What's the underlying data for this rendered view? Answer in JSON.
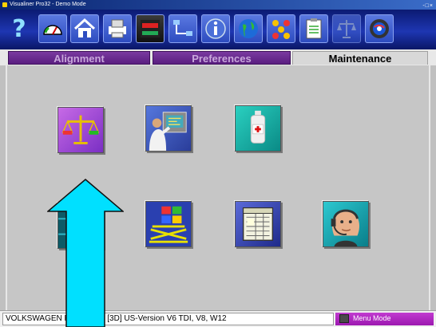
{
  "window": {
    "title": "Visualiner Pro32 - Demo Mode",
    "controls": "-□×"
  },
  "toolbar": {
    "buttons": [
      {
        "icon": "help-icon",
        "glyph": "?"
      },
      {
        "icon": "gauge-icon"
      },
      {
        "icon": "home-icon"
      },
      {
        "icon": "printer-icon"
      },
      {
        "icon": "book-icon"
      },
      {
        "icon": "network-icon"
      },
      {
        "icon": "info-icon"
      },
      {
        "icon": "globe-icon"
      },
      {
        "icon": "molecule-icon"
      },
      {
        "icon": "clipboard-icon"
      },
      {
        "icon": "scale-icon"
      },
      {
        "icon": "target-icon"
      }
    ]
  },
  "tabs": [
    {
      "label": "Alignment",
      "active": false
    },
    {
      "label": "Preferences",
      "active": false
    },
    {
      "label": "Maintenance",
      "active": true
    }
  ],
  "maintenance_icons": [
    {
      "name": "calibration-scale-icon",
      "highlighted": true
    },
    {
      "name": "technician-panel-icon",
      "highlighted": false
    },
    {
      "name": "first-aid-bottle-icon",
      "highlighted": false
    },
    {
      "name": "tire-icon",
      "highlighted": false
    },
    {
      "name": "windows-lift-icon",
      "highlighted": false
    },
    {
      "name": "spreadsheet-icon",
      "highlighted": false
    },
    {
      "name": "headset-support-icon",
      "highlighted": false
    }
  ],
  "status": {
    "vehicle": "VOLKSWAGEN PHAETON, [3D] US-Version V6 TDI, V8,  W12",
    "mode": "Menu Mode"
  },
  "colors": {
    "toolbar_bg": "#1e36b2",
    "tab_inactive": "#5a1e80",
    "tab_active": "#d8d8d8",
    "arrow_fill": "#00e0ff",
    "status_mode_bg": "#9c18b0"
  }
}
